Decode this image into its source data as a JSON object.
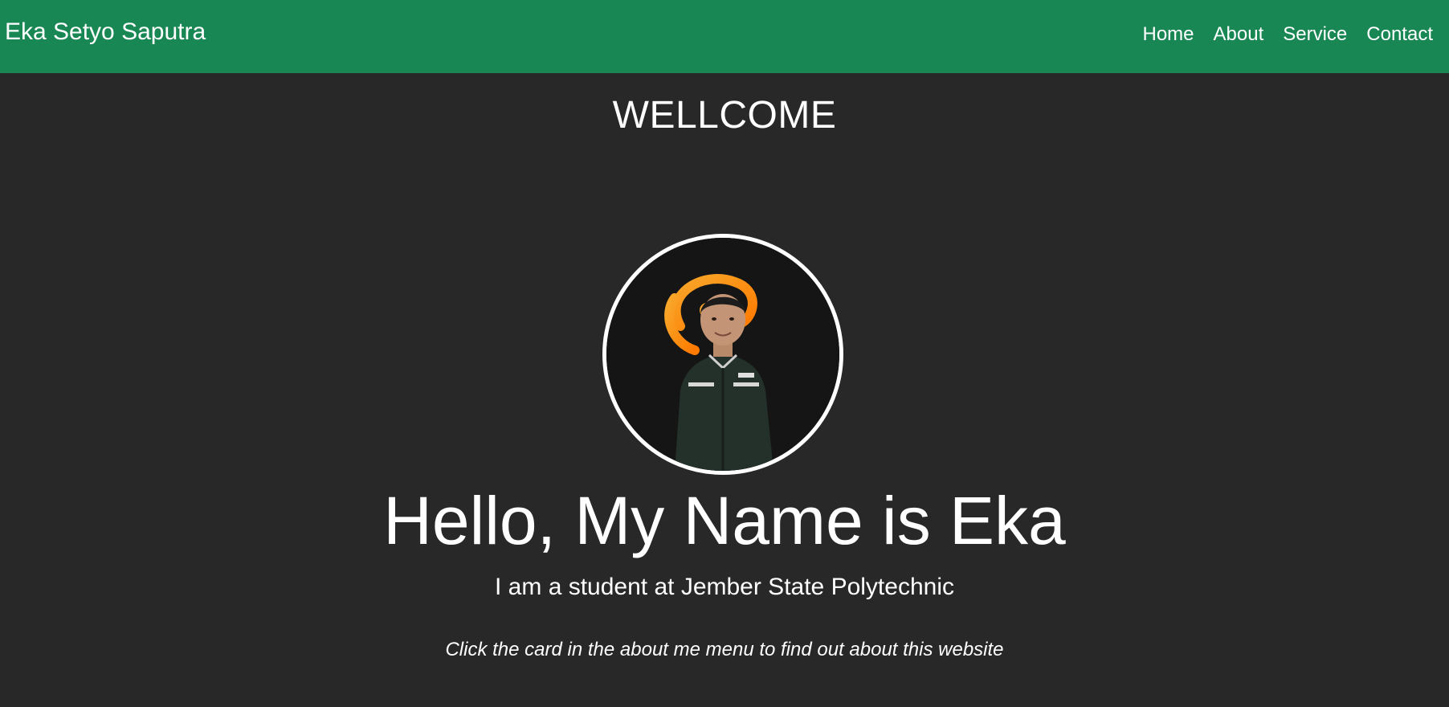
{
  "navbar": {
    "brand": "Eka Setyo Saputra",
    "links": [
      {
        "label": "Home"
      },
      {
        "label": "About"
      },
      {
        "label": "Service"
      },
      {
        "label": "Contact"
      }
    ],
    "background_color": "#198754"
  },
  "main": {
    "welcome": "WELLCOME",
    "avatar_icon": "profile-photo",
    "hero_title": "Hello, My Name is Eka",
    "subtitle": "I am a student at Jember State Polytechnic",
    "hint": "Click the card in the about me menu to find out about this website",
    "background_color": "#282828"
  }
}
